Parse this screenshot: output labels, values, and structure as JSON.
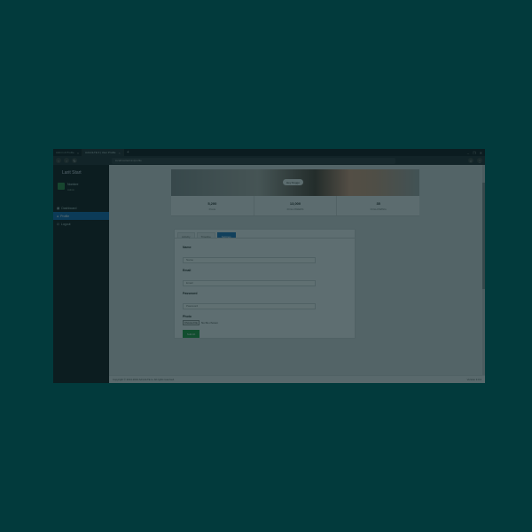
{
  "browser": {
    "tabs": [
      {
        "label": "Admin & Profile"
      },
      {
        "label": "AdminLTE 3 | User Profile"
      }
    ],
    "new_tab_symbol": "+",
    "window_controls": [
      "–",
      "❐",
      "✕"
    ],
    "url": "localhost/admin/profile"
  },
  "sidebar": {
    "logo": "Larit Start",
    "user_name": "Nombre",
    "user_status": "Admin",
    "items": [
      {
        "label": "Dashboard",
        "active": false
      },
      {
        "label": "Profile",
        "active": true
      },
      {
        "label": "Logout",
        "active": false
      }
    ]
  },
  "profile": {
    "cover_tag": "Hey Doggo",
    "stats": [
      {
        "value": "5,200",
        "label": "Posts"
      },
      {
        "value": "13,000",
        "label": "FOLLOWERS"
      },
      {
        "value": "35",
        "label": "FOLLOWING"
      }
    ]
  },
  "form": {
    "tabs": [
      {
        "label": "Activity",
        "active": false
      },
      {
        "label": "Timeline",
        "active": false
      },
      {
        "label": "Settings",
        "active": true
      }
    ],
    "name_label": "Name",
    "name_placeholder": "Name",
    "email_label": "Email",
    "email_placeholder": "Email",
    "password_label": "Password",
    "password_placeholder": "Password",
    "photo_label": "Photo",
    "choose_file": "Choose File",
    "no_file": "No file chosen",
    "submit": "Submit"
  },
  "footer": {
    "copyright": "Copyright © 2014-2019 AdminLTE.io. All rights reserved.",
    "version": "Version 3.0.0"
  },
  "colors": {
    "backdrop": "#023a3c",
    "sidebar": "#1e2124",
    "active_nav": "#1f6fb5",
    "submit": "#2ea04a"
  }
}
